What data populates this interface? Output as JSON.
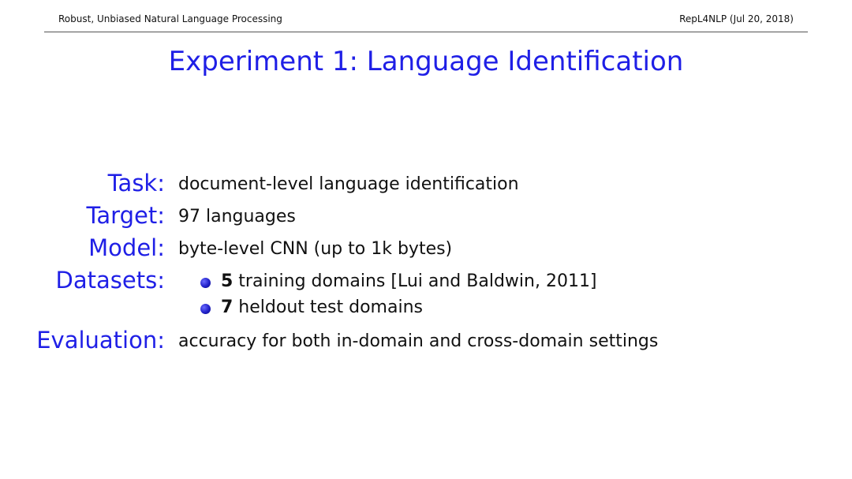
{
  "header": {
    "left_text": "Robust, Unbiased Natural Language Processing",
    "right_text": "RepL4NLP (Jul 20, 2018)"
  },
  "title": "Experiment 1: Language Identification",
  "items": [
    {
      "label": "Task:",
      "value": "document-level language identification"
    },
    {
      "label": "Target:",
      "value": "97 languages"
    },
    {
      "label": "Model:",
      "value": "byte-level CNN (up to 1k bytes)"
    },
    {
      "label": "Datasets:",
      "value": ""
    }
  ],
  "datasets": [
    {
      "count": "5",
      "text": " training domains [Lui and Baldwin, 2011]"
    },
    {
      "count": "7",
      "text": " heldout test domains"
    }
  ],
  "evaluation": {
    "label": "Evaluation:",
    "value": "accuracy for both in-domain and cross-domain settings"
  },
  "colors": {
    "accent": "#1f1fe6",
    "text": "#111111",
    "rule": "#555555"
  }
}
